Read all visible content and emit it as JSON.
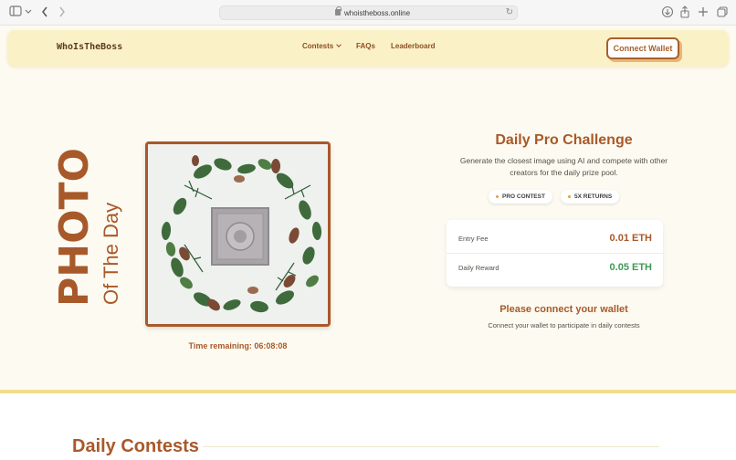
{
  "browser": {
    "url": "whoistheboss.online",
    "icons": [
      "sidebar-icon",
      "chevron-down-icon",
      "back-icon",
      "forward-icon",
      "lock-icon",
      "reload-icon",
      "download-icon",
      "share-icon",
      "new-tab-icon",
      "tabs-overview-icon"
    ]
  },
  "nav": {
    "brand": "WhoIsTheBoss",
    "items": [
      {
        "label": "Contests"
      },
      {
        "label": "FAQs"
      },
      {
        "label": "Leaderboard"
      }
    ],
    "connect_label": "Connect Wallet"
  },
  "hero": {
    "vertical_title": "PHOTO",
    "vertical_subtitle": "Of The Day",
    "timer": "Time remaining: 06:08:08"
  },
  "challenge": {
    "title": "Daily Pro Challenge",
    "description": "Generate the closest image using AI and compete with other creators for the daily prize pool.",
    "tags": [
      "PRO CONTEST",
      "5X RETURNS"
    ],
    "entry_fee_label": "Entry Fee",
    "entry_fee_value": "0.01 ETH",
    "reward_label": "Daily Reward",
    "reward_value": "0.05 ETH",
    "wallet_title": "Please connect your wallet",
    "wallet_subtitle": "Connect your wallet to participate in daily contests"
  },
  "section": {
    "daily_contests_title": "Daily Contests"
  },
  "colors": {
    "accent": "#a8592a",
    "nav_bg": "#fbf1c7",
    "page_bg": "#fdfbf1",
    "fee_color": "#a8592a",
    "reward_color": "#3f9a52"
  }
}
